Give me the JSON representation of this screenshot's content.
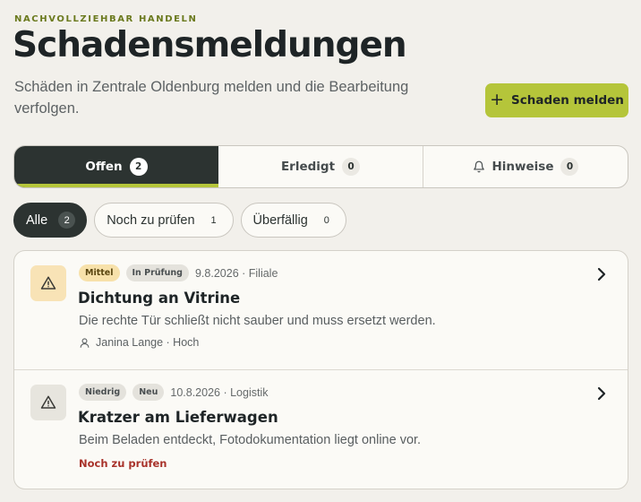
{
  "header": {
    "eyebrow": "NACHVOLLZIEHBAR HANDELN",
    "title": "Schadensmeldungen",
    "subtitle": "Schäden in Zentrale Oldenburg melden und die Bearbeitung verfolgen.",
    "action_icon": "plus-icon",
    "action_label": "Schaden melden"
  },
  "tabs": [
    {
      "label": "Offen",
      "count": "2",
      "active": true
    },
    {
      "label": "Erledigt",
      "count": "0",
      "active": false
    },
    {
      "label": "Hinweise",
      "count": "0",
      "active": false,
      "icon": "bell-icon"
    }
  ],
  "filters": [
    {
      "label": "Alle",
      "count": "2",
      "active": true
    },
    {
      "label": "Noch zu prüfen",
      "count": "1",
      "active": false
    },
    {
      "label": "Überfällig",
      "count": "0",
      "active": false
    }
  ],
  "reports": [
    {
      "icon": "warning-icon",
      "priority": "Mittel",
      "status": "In Prüfung",
      "meta": "9.8.2026 · Filiale",
      "title": "Dichtung an Vitrine",
      "description": "Die rechte Tür schließt nicht sauber und muss ersetzt werden.",
      "assignee": "Janina Lange · Hoch"
    },
    {
      "icon": "warning-icon",
      "priority": "Niedrig",
      "status": "Neu",
      "meta": "10.8.2026 · Logistik",
      "title": "Kratzer am Lieferwagen",
      "description": "Beim Beladen entdeckt, Fotodokumentation liegt online vor.",
      "alert": "Noch zu prüfen"
    }
  ],
  "colors": {
    "accent": "#b5c53a",
    "dark": "#2c3331",
    "background": "#f2f0eb",
    "alert": "#a8322a"
  }
}
